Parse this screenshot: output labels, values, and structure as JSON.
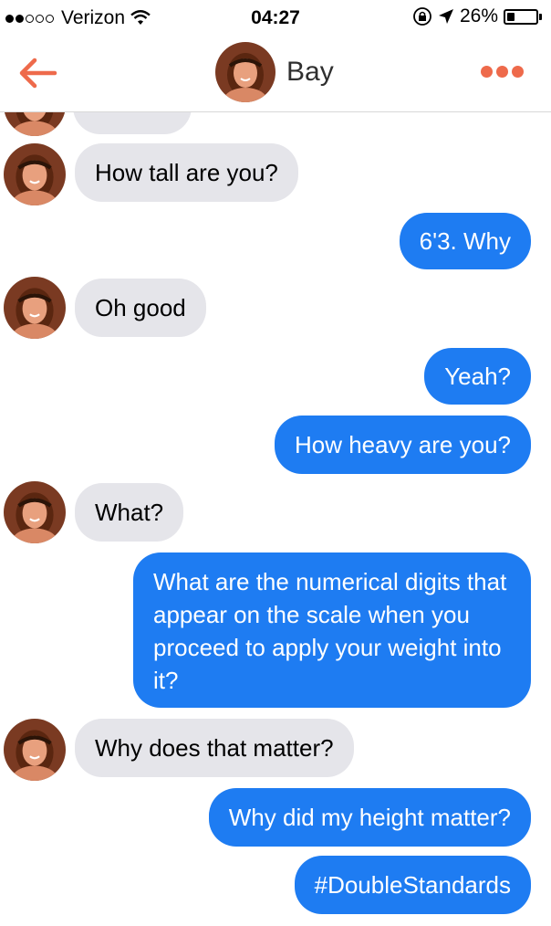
{
  "status_bar": {
    "carrier": "Verizon",
    "time": "04:27",
    "battery_percent": "26%",
    "battery_level": 0.26,
    "signal_bars_filled": 2,
    "signal_bars_total": 5
  },
  "header": {
    "contact_name": "Bay",
    "accent_color": "#ee6a4b"
  },
  "messages": [
    {
      "side": "in",
      "text": "How tall are you?"
    },
    {
      "side": "out",
      "text": "6'3. Why"
    },
    {
      "side": "in",
      "text": "Oh good"
    },
    {
      "side": "out",
      "text": "Yeah?"
    },
    {
      "side": "out",
      "text": "How heavy are you?"
    },
    {
      "side": "in",
      "text": "What?"
    },
    {
      "side": "out",
      "text": "What are the numerical digits that appear on the scale when you proceed to apply your weight into it?"
    },
    {
      "side": "in",
      "text": "Why does that matter?"
    },
    {
      "side": "out",
      "text": "Why did my height matter?"
    },
    {
      "side": "out",
      "text": "#DoubleStandards"
    }
  ],
  "colors": {
    "incoming_bubble": "#e5e5ea",
    "outgoing_bubble": "#1e7cf2"
  }
}
